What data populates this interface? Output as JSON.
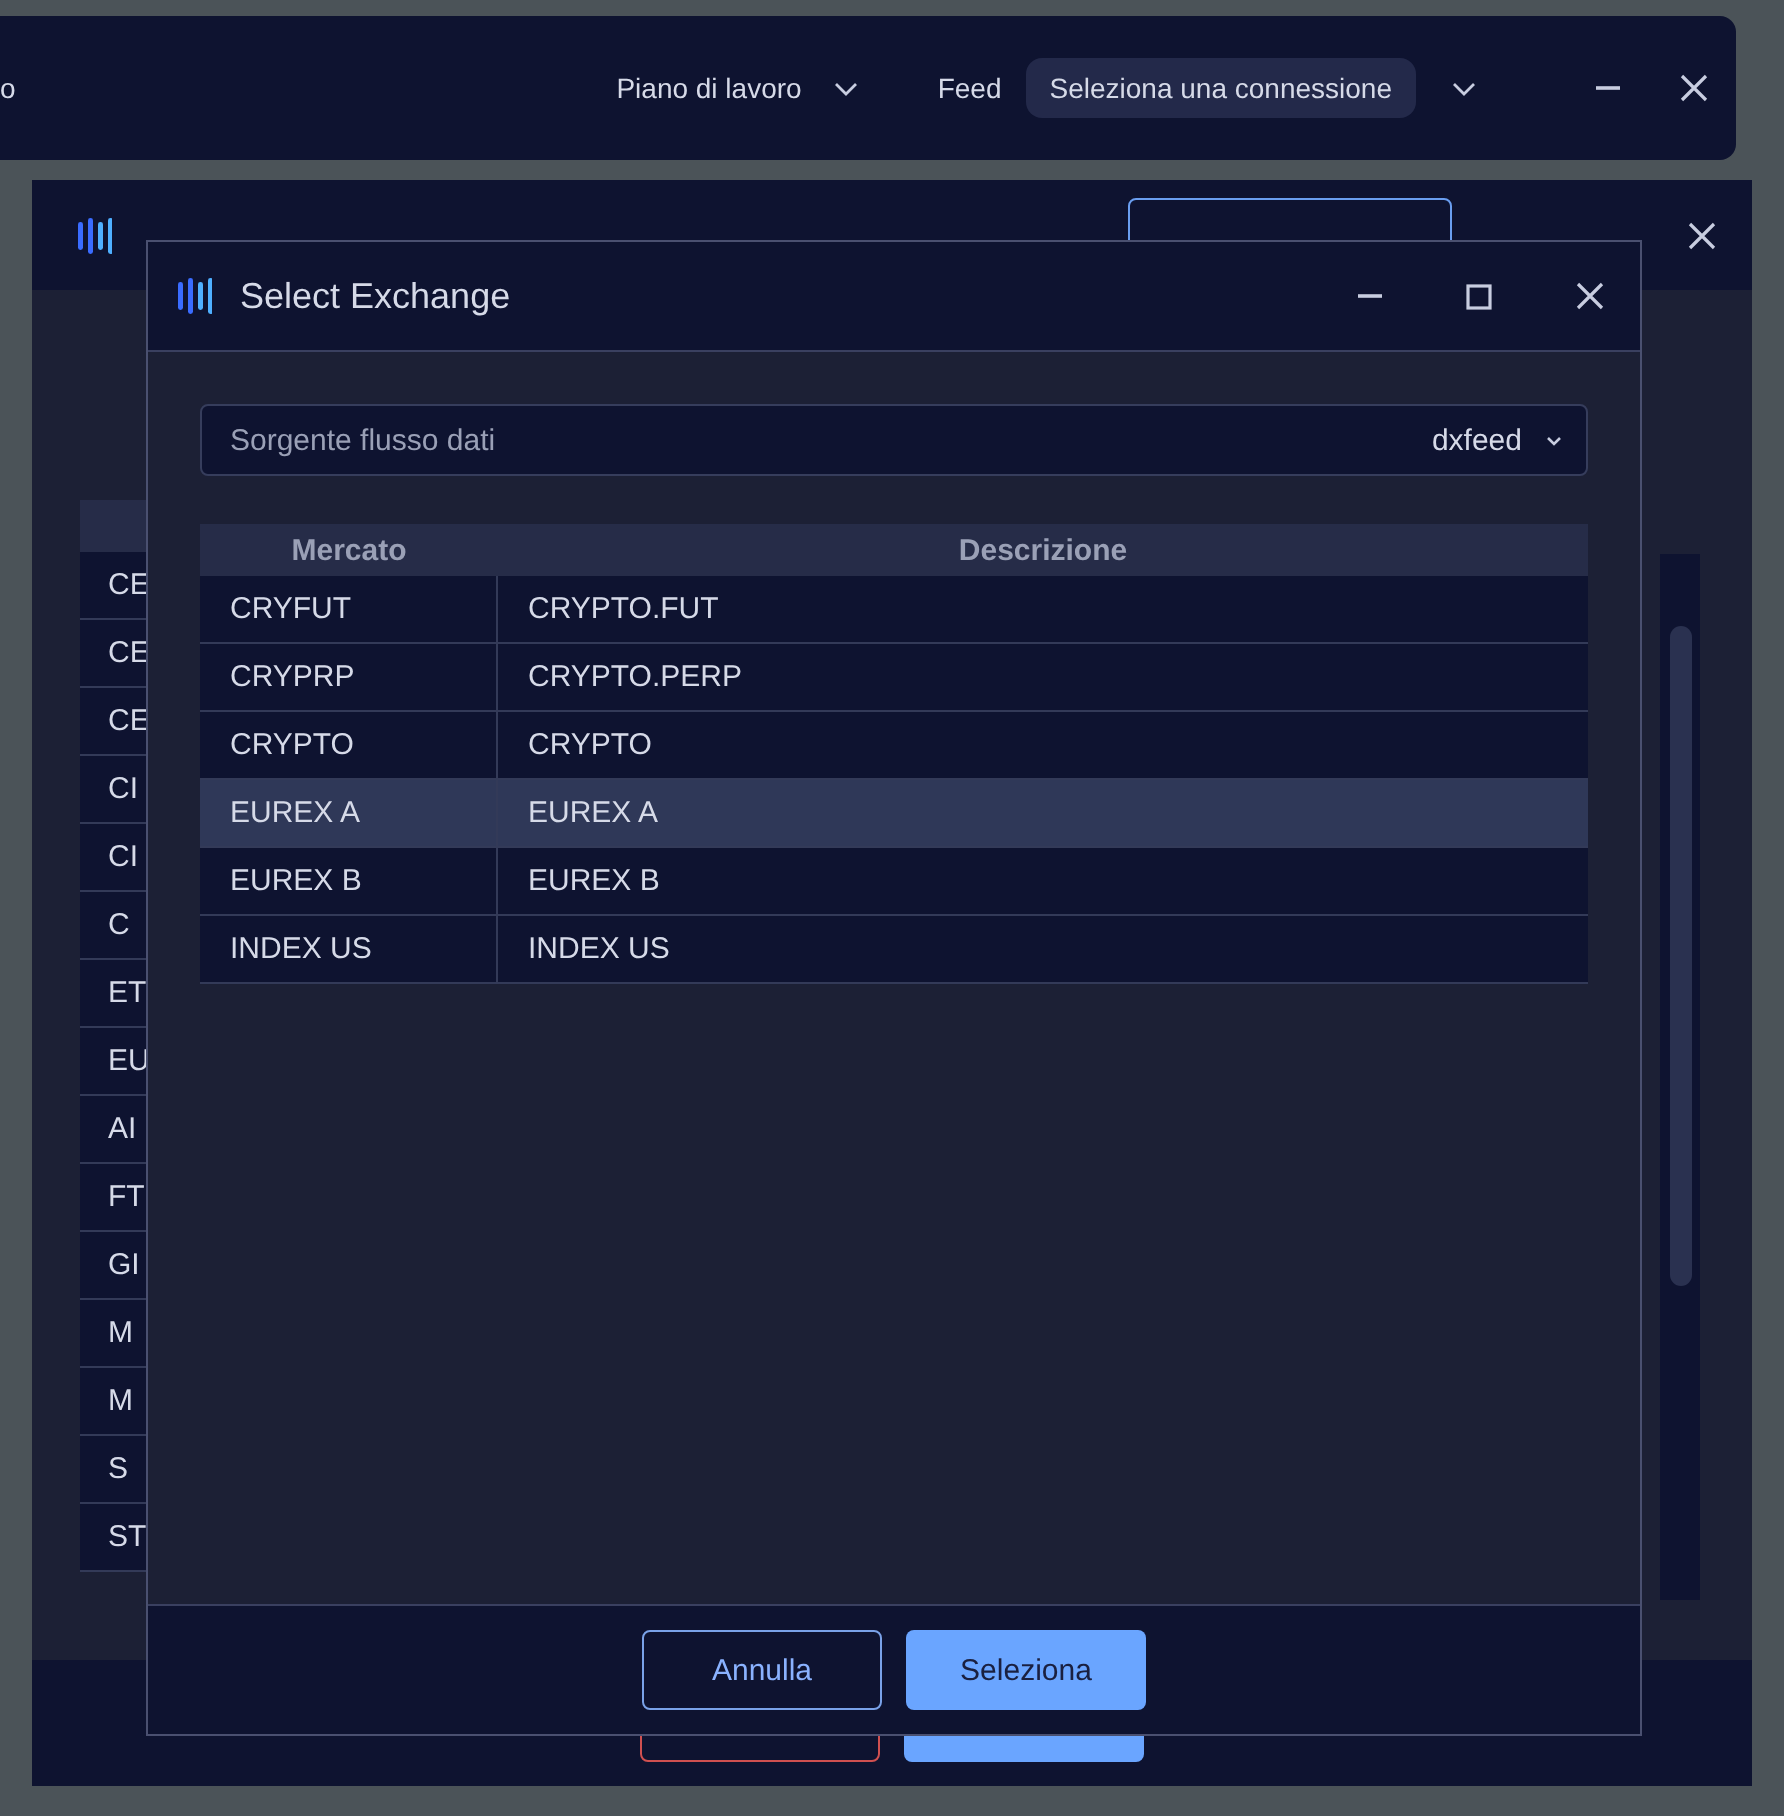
{
  "top_bar": {
    "edge_text": "o",
    "workspace": "Piano di lavoro",
    "feed_label": "Feed",
    "connection": "Seleziona una connessione"
  },
  "back_window": {
    "rows": [
      "CE",
      "CE",
      "CE",
      "CI",
      "CI",
      "C",
      "ET",
      "EU",
      "AI",
      "FT",
      "GI",
      "M",
      "M",
      "S",
      "ST"
    ]
  },
  "dialog": {
    "title": "Select Exchange",
    "source": {
      "placeholder": "Sorgente flusso dati",
      "value": "dxfeed"
    },
    "table": {
      "columns": [
        "Mercato",
        "Descrizione"
      ],
      "rows": [
        {
          "market": "CRYFUT",
          "description": "CRYPTO.FUT",
          "selected": false
        },
        {
          "market": "CRYPRP",
          "description": "CRYPTO.PERP",
          "selected": false
        },
        {
          "market": "CRYPTO",
          "description": "CRYPTO",
          "selected": false
        },
        {
          "market": "EUREX A",
          "description": "EUREX A",
          "selected": true
        },
        {
          "market": "EUREX B",
          "description": "EUREX B",
          "selected": false
        },
        {
          "market": "INDEX US",
          "description": "INDEX US",
          "selected": false
        }
      ]
    },
    "buttons": {
      "cancel": "Annulla",
      "confirm": "Seleziona"
    }
  }
}
